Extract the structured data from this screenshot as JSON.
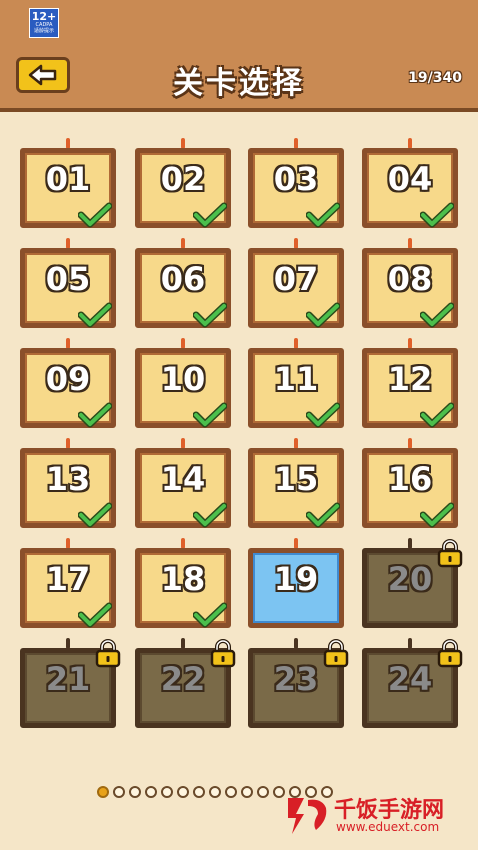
{
  "header": {
    "age_rating": "12+",
    "age_sub": "CADPA",
    "age_note": "适龄提示",
    "title": "关卡选择",
    "progress": "19/340",
    "back_icon": "arrow-left-icon"
  },
  "colors": {
    "header_bg": "#c98a53",
    "page_bg": "#f5e6c8",
    "completed_card": "#f7d98a",
    "current_card": "#7cc4f2",
    "locked_card": "#7a6a48",
    "check": "#4cbf4c",
    "lock": "#f2c21a"
  },
  "levels": [
    {
      "label": "01",
      "state": "completed"
    },
    {
      "label": "02",
      "state": "completed"
    },
    {
      "label": "03",
      "state": "completed"
    },
    {
      "label": "04",
      "state": "completed"
    },
    {
      "label": "05",
      "state": "completed"
    },
    {
      "label": "06",
      "state": "completed"
    },
    {
      "label": "07",
      "state": "completed"
    },
    {
      "label": "08",
      "state": "completed"
    },
    {
      "label": "09",
      "state": "completed"
    },
    {
      "label": "10",
      "state": "completed"
    },
    {
      "label": "11",
      "state": "completed"
    },
    {
      "label": "12",
      "state": "completed"
    },
    {
      "label": "13",
      "state": "completed"
    },
    {
      "label": "14",
      "state": "completed"
    },
    {
      "label": "15",
      "state": "completed"
    },
    {
      "label": "16",
      "state": "completed"
    },
    {
      "label": "17",
      "state": "completed"
    },
    {
      "label": "18",
      "state": "completed"
    },
    {
      "label": "19",
      "state": "current"
    },
    {
      "label": "20",
      "state": "locked"
    },
    {
      "label": "21",
      "state": "locked"
    },
    {
      "label": "22",
      "state": "locked"
    },
    {
      "label": "23",
      "state": "locked"
    },
    {
      "label": "24",
      "state": "locked"
    }
  ],
  "pagination": {
    "total_pages": 15,
    "current_page": 1
  },
  "watermark": {
    "name": "千饭手游网",
    "url": "www.eduext.com"
  }
}
